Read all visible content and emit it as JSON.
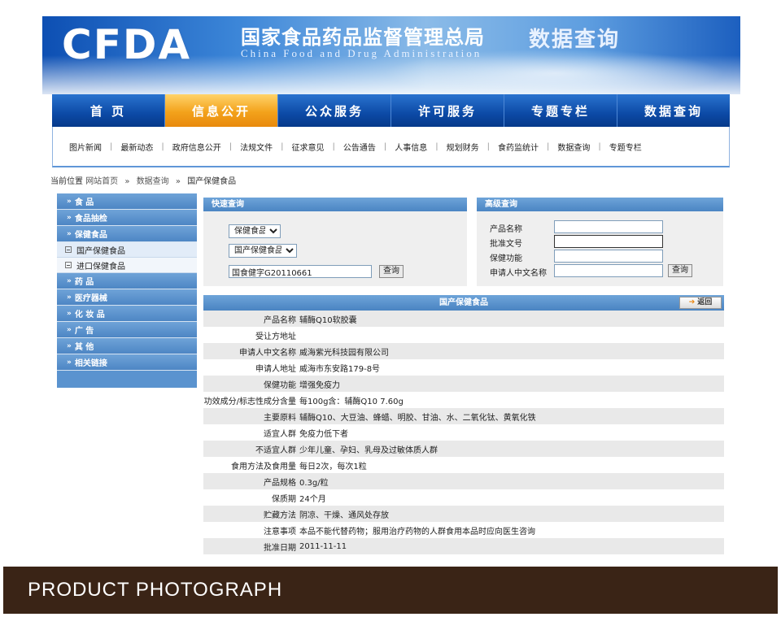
{
  "banner": {
    "logo": "CFDA",
    "org_cn": "国家食品药品监督管理总局",
    "org_en": "China Food and Drug Administration",
    "title": "数据查询"
  },
  "main_nav": [
    {
      "label": "首  页",
      "active": false
    },
    {
      "label": "信息公开",
      "active": true
    },
    {
      "label": "公众服务",
      "active": false
    },
    {
      "label": "许可服务",
      "active": false
    },
    {
      "label": "专题专栏",
      "active": false
    },
    {
      "label": "数据查询",
      "active": false
    }
  ],
  "sub_nav": [
    "图片新闻",
    "最新动态",
    "政府信息公开",
    "法规文件",
    "征求意见",
    "公告通告",
    "人事信息",
    "规划财务",
    "食药监统计",
    "数据查询",
    "专题专栏"
  ],
  "breadcrumb": {
    "prefix": "当前位置",
    "items": [
      "网站首页",
      "数据查询",
      "国产保健食品"
    ]
  },
  "sidebar": {
    "items": [
      {
        "label": "食    品",
        "type": "main"
      },
      {
        "label": "食品抽检",
        "type": "main"
      },
      {
        "label": "保健食品",
        "type": "main"
      },
      {
        "label": "国产保健食品",
        "type": "sub",
        "active": true
      },
      {
        "label": "进口保健食品",
        "type": "sub",
        "active": false
      },
      {
        "label": "药    品",
        "type": "main"
      },
      {
        "label": "医疗器械",
        "type": "main"
      },
      {
        "label": "化 妆 品",
        "type": "main"
      },
      {
        "label": "广    告",
        "type": "main"
      },
      {
        "label": "其    他",
        "type": "main"
      },
      {
        "label": "相关链接",
        "type": "main"
      }
    ]
  },
  "quick_search": {
    "title": "快速查询",
    "select1": "保健食品",
    "select2": "国产保健食品",
    "input_value": "国食健字G20110661",
    "button": "查询"
  },
  "advanced_search": {
    "title": "高级查询",
    "fields": [
      {
        "label": "产品名称",
        "value": ""
      },
      {
        "label": "批准文号",
        "value": ""
      },
      {
        "label": "保健功能",
        "value": ""
      },
      {
        "label": "申请人中文名称",
        "value": ""
      }
    ],
    "button": "查询"
  },
  "detail": {
    "title": "国产保健食品",
    "back_label": "返回",
    "rows": [
      {
        "label": "产品名称",
        "value": "辅酶Q10软胶囊"
      },
      {
        "label": "受让方地址",
        "value": ""
      },
      {
        "label": "申请人中文名称",
        "value": "威海紫光科技园有限公司"
      },
      {
        "label": "申请人地址",
        "value": "威海市东安路179-8号"
      },
      {
        "label": "保健功能",
        "value": "增强免疫力"
      },
      {
        "label": "功效成分/标志性成分含量",
        "value": "每100g含：辅酶Q10 7.60g"
      },
      {
        "label": "主要原料",
        "value": "辅酶Q10、大豆油、蜂蜡、明胶、甘油、水、二氧化钛、黄氧化铁"
      },
      {
        "label": "适宜人群",
        "value": "免疫力低下者"
      },
      {
        "label": "不适宜人群",
        "value": "少年儿童、孕妇、乳母及过敏体质人群"
      },
      {
        "label": "食用方法及食用量",
        "value": "每日2次，每次1粒"
      },
      {
        "label": "产品规格",
        "value": "0.3g/粒"
      },
      {
        "label": "保质期",
        "value": "24个月"
      },
      {
        "label": "贮藏方法",
        "value": "阴凉、干燥、通风处存放"
      },
      {
        "label": "注意事项",
        "value": "本品不能代替药物；服用治疗药物的人群食用本品时应向医生咨询"
      },
      {
        "label": "批准日期",
        "value": "2011-11-11"
      }
    ]
  },
  "footer": {
    "label": "PRODUCT PHOTOGRAPH"
  }
}
